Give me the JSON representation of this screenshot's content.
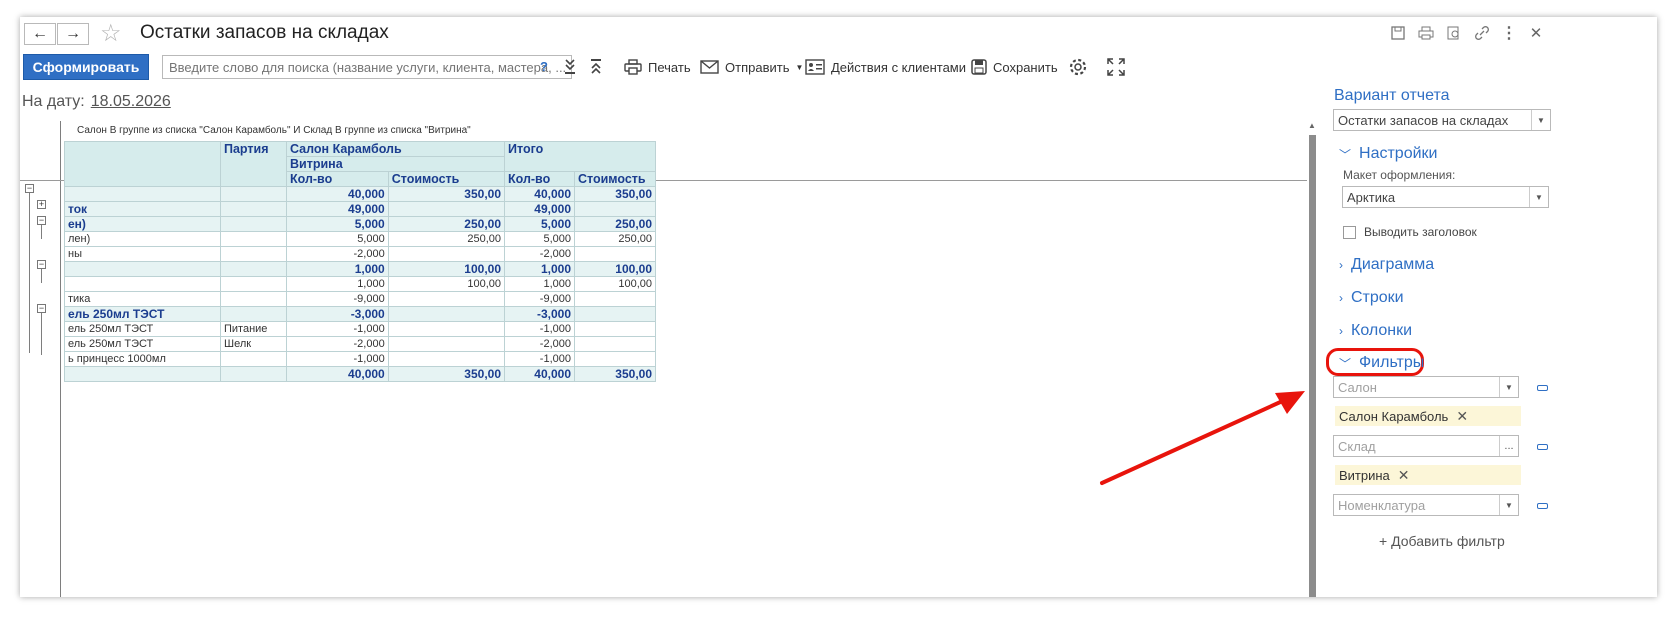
{
  "window": {
    "title": "Остатки запасов на складах"
  },
  "nav": {
    "back": "←",
    "forward": "→",
    "star": "☆"
  },
  "titlebar_icons": [
    "save-icon",
    "print-icon",
    "preview-icon",
    "link-icon",
    "more-icon",
    "close-icon"
  ],
  "toolbar": {
    "generate_label": "Сформировать",
    "search_placeholder": "Введите слово для поиска (название услуги, клиента, мастера, ...",
    "help": "?",
    "print_label": "Печать",
    "send_label": "Отправить",
    "clients_label": "Действия с клиентами",
    "save_label": "Сохранить"
  },
  "date": {
    "label": "На дату:",
    "value": "18.05.2026"
  },
  "report": {
    "caption": "Салон В группе из списка \"Салон Карамболь\" И Склад В группе из списка \"Витрина\"",
    "headers": {
      "party": "Партия",
      "salon": "Салон Карамболь",
      "store": "Витрина",
      "total": "Итого",
      "qty": "Кол-во",
      "cost": "Стоимость"
    },
    "rows": [
      {
        "name": "",
        "party": "",
        "q1": "40,000",
        "c1": "350,00",
        "q2": "40,000",
        "c2": "350,00",
        "bold": true
      },
      {
        "name": "ток",
        "party": "",
        "q1": "49,000",
        "c1": "",
        "q2": "49,000",
        "c2": "",
        "bold": true
      },
      {
        "name": "ен)",
        "party": "",
        "q1": "5,000",
        "c1": "250,00",
        "q2": "5,000",
        "c2": "250,00",
        "bold": true
      },
      {
        "name": "лен)",
        "party": "",
        "q1": "5,000",
        "c1": "250,00",
        "q2": "5,000",
        "c2": "250,00",
        "bold": false
      },
      {
        "name": "ны",
        "party": "",
        "q1": "-2,000",
        "c1": "",
        "q2": "-2,000",
        "c2": "",
        "bold": false
      },
      {
        "name": "",
        "party": "",
        "q1": "1,000",
        "c1": "100,00",
        "q2": "1,000",
        "c2": "100,00",
        "bold": true
      },
      {
        "name": "",
        "party": "",
        "q1": "1,000",
        "c1": "100,00",
        "q2": "1,000",
        "c2": "100,00",
        "bold": false
      },
      {
        "name": "тика",
        "party": "",
        "q1": "-9,000",
        "c1": "",
        "q2": "-9,000",
        "c2": "",
        "bold": false
      },
      {
        "name": "ель 250мл ТЭСТ",
        "party": "",
        "q1": "-3,000",
        "c1": "",
        "q2": "-3,000",
        "c2": "",
        "bold": true
      },
      {
        "name": "ель 250мл ТЭСТ",
        "party": "Питание",
        "q1": "-1,000",
        "c1": "",
        "q2": "-1,000",
        "c2": "",
        "bold": false
      },
      {
        "name": "ель 250мл ТЭСТ",
        "party": "Шелк",
        "q1": "-2,000",
        "c1": "",
        "q2": "-2,000",
        "c2": "",
        "bold": false
      },
      {
        "name": "ь принцесс 1000мл",
        "party": "",
        "q1": "-1,000",
        "c1": "",
        "q2": "-1,000",
        "c2": "",
        "bold": false
      },
      {
        "name": "",
        "party": "",
        "q1": "40,000",
        "c1": "350,00",
        "q2": "40,000",
        "c2": "350,00",
        "bold": true
      }
    ]
  },
  "panel": {
    "variant_title": "Вариант отчета",
    "variant_value": "Остатки запасов на складах",
    "settings_label": "Настройки",
    "layout_label": "Макет оформления:",
    "layout_value": "Арктика",
    "show_header_label": "Выводить заголовок",
    "diagram_label": "Диаграмма",
    "rows_label": "Строки",
    "columns_label": "Колонки",
    "filters_label": "Фильтры",
    "salon_placeholder": "Салон",
    "salon_tag": "Салон Карамболь",
    "store_placeholder": "Склад",
    "store_tag": "Витрина",
    "nomen_placeholder": "Номенклатура",
    "add_filter_label": "+ Добавить фильтр",
    "ellipsis": "..."
  },
  "colors": {
    "accent": "#2f6fc4",
    "highlight": "#e8140c",
    "tag_bg": "#fcf6d8",
    "table_header": "#d6ecec"
  }
}
